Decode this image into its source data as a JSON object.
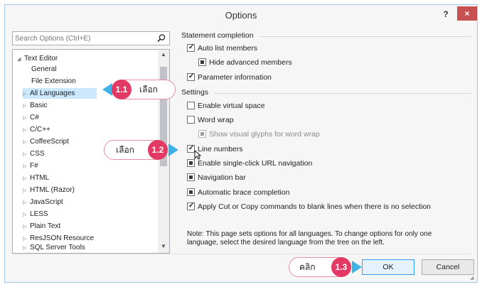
{
  "window": {
    "title": "Options",
    "help_label": "?",
    "close_label": "×"
  },
  "search": {
    "placeholder": "Search Options (Ctrl+E)"
  },
  "tree": {
    "items": [
      {
        "label": "Text Editor",
        "arrow": "◢"
      },
      {
        "label": "General",
        "arrow": ""
      },
      {
        "label": "File Extension",
        "arrow": ""
      },
      {
        "label": "All Languages",
        "arrow": "▷"
      },
      {
        "label": "Basic",
        "arrow": "▷"
      },
      {
        "label": "C#",
        "arrow": "▷"
      },
      {
        "label": "C/C++",
        "arrow": "▷"
      },
      {
        "label": "CoffeeScript",
        "arrow": "▷"
      },
      {
        "label": "CSS",
        "arrow": "▷"
      },
      {
        "label": "F#",
        "arrow": "▷"
      },
      {
        "label": "HTML",
        "arrow": "▷"
      },
      {
        "label": "HTML (Razor)",
        "arrow": "▷"
      },
      {
        "label": "JavaScript",
        "arrow": "▷"
      },
      {
        "label": "LESS",
        "arrow": "▷"
      },
      {
        "label": "Plain Text",
        "arrow": "▷"
      },
      {
        "label": "ResJSON Resource",
        "arrow": "▷"
      },
      {
        "label": "SQL Server Tools",
        "arrow": "▷"
      }
    ],
    "scroll_up": "▲",
    "scroll_down": "▼"
  },
  "statement_completion": {
    "heading": "Statement completion",
    "auto_list_members": "Auto list members",
    "hide_advanced_members": "Hide advanced members",
    "parameter_information": "Parameter information"
  },
  "settings": {
    "heading": "Settings",
    "enable_virtual_space": "Enable virtual space",
    "word_wrap": "Word wrap",
    "show_visual_glyphs": "Show visual glyphs for word wrap",
    "line_numbers": "Line numbers",
    "single_click_url": "Enable single-click URL navigation",
    "navigation_bar": "Navigation bar",
    "automatic_brace": "Automatic brace completion",
    "apply_cut_copy": "Apply Cut or Copy commands to blank lines when there is no selection"
  },
  "note": {
    "line1": "Note: This page sets options for all languages. To change options for only one",
    "line2": "language, select the desired language from the tree on the left."
  },
  "buttons": {
    "ok": "OK",
    "cancel": "Cancel"
  },
  "annotations": {
    "step1_num": "1.1",
    "step1_text": "เลือก",
    "step2_num": "1.2",
    "step2_text": "เลือก",
    "step3_num": "1.3",
    "step3_text": "คลิก"
  },
  "colors": {
    "accent": "#e23a64",
    "pointer": "#3fb1e5",
    "selection": "#cce8ff",
    "close": "#c75050"
  }
}
